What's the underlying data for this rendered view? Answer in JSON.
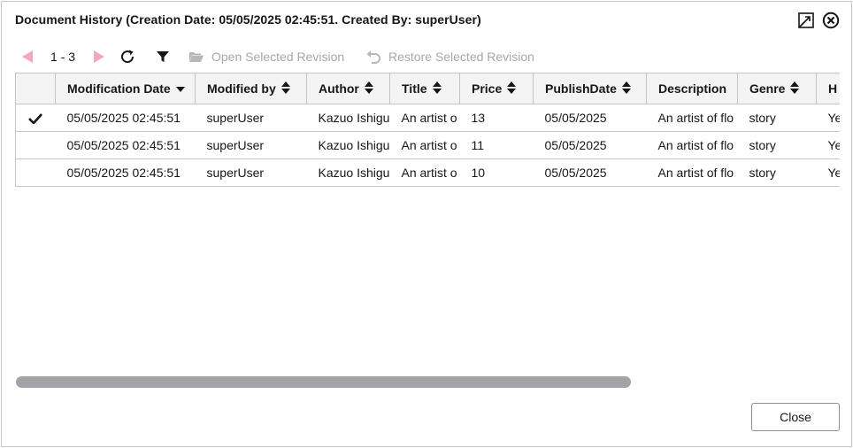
{
  "dialog": {
    "title": "Document History (Creation Date: 05/05/2025 02:45:51. Created By: superUser)",
    "close_label": "Close"
  },
  "toolbar": {
    "range": "1 - 3",
    "open_revision": "Open Selected Revision",
    "restore_revision": "Restore Selected Revision"
  },
  "columns": [
    {
      "label": "Modification Date",
      "sort": "desc"
    },
    {
      "label": "Modified by",
      "sort": "both"
    },
    {
      "label": "Author",
      "sort": "both"
    },
    {
      "label": "Title",
      "sort": "both"
    },
    {
      "label": "Price",
      "sort": "both"
    },
    {
      "label": "PublishDate",
      "sort": "both"
    },
    {
      "label": "Description",
      "sort": "none"
    },
    {
      "label": "Genre",
      "sort": "both"
    },
    {
      "label": "H",
      "sort": "none"
    }
  ],
  "rows": [
    {
      "selected": true,
      "cells": [
        "05/05/2025 02:45:51",
        "superUser",
        "Kazuo Ishigu",
        "An artist o",
        "13",
        "05/05/2025",
        "An artist of flo",
        "story",
        "Ye"
      ]
    },
    {
      "selected": false,
      "cells": [
        "05/05/2025 02:45:51",
        "superUser",
        "Kazuo Ishigu",
        "An artist o",
        "11",
        "05/05/2025",
        "An artist of flo",
        "story",
        "Ye"
      ]
    },
    {
      "selected": false,
      "cells": [
        "05/05/2025 02:45:51",
        "superUser",
        "Kazuo Ishigu",
        "An artist o",
        "10",
        "05/05/2025",
        "An artist of flo",
        "story",
        "Ye"
      ]
    }
  ],
  "colors": {
    "nav_arrow": "#f0a6c9",
    "disabled_text": "#a8a8a8",
    "scrollbar": "#a2a2a8"
  },
  "icons": {
    "maximize": "maximize-icon",
    "close": "close-circle-icon",
    "prev": "prev-page-icon",
    "next": "next-page-icon",
    "refresh": "refresh-icon",
    "filter": "filter-icon",
    "folder": "folder-open-icon",
    "undo": "undo-icon",
    "check": "checkmark-icon"
  }
}
